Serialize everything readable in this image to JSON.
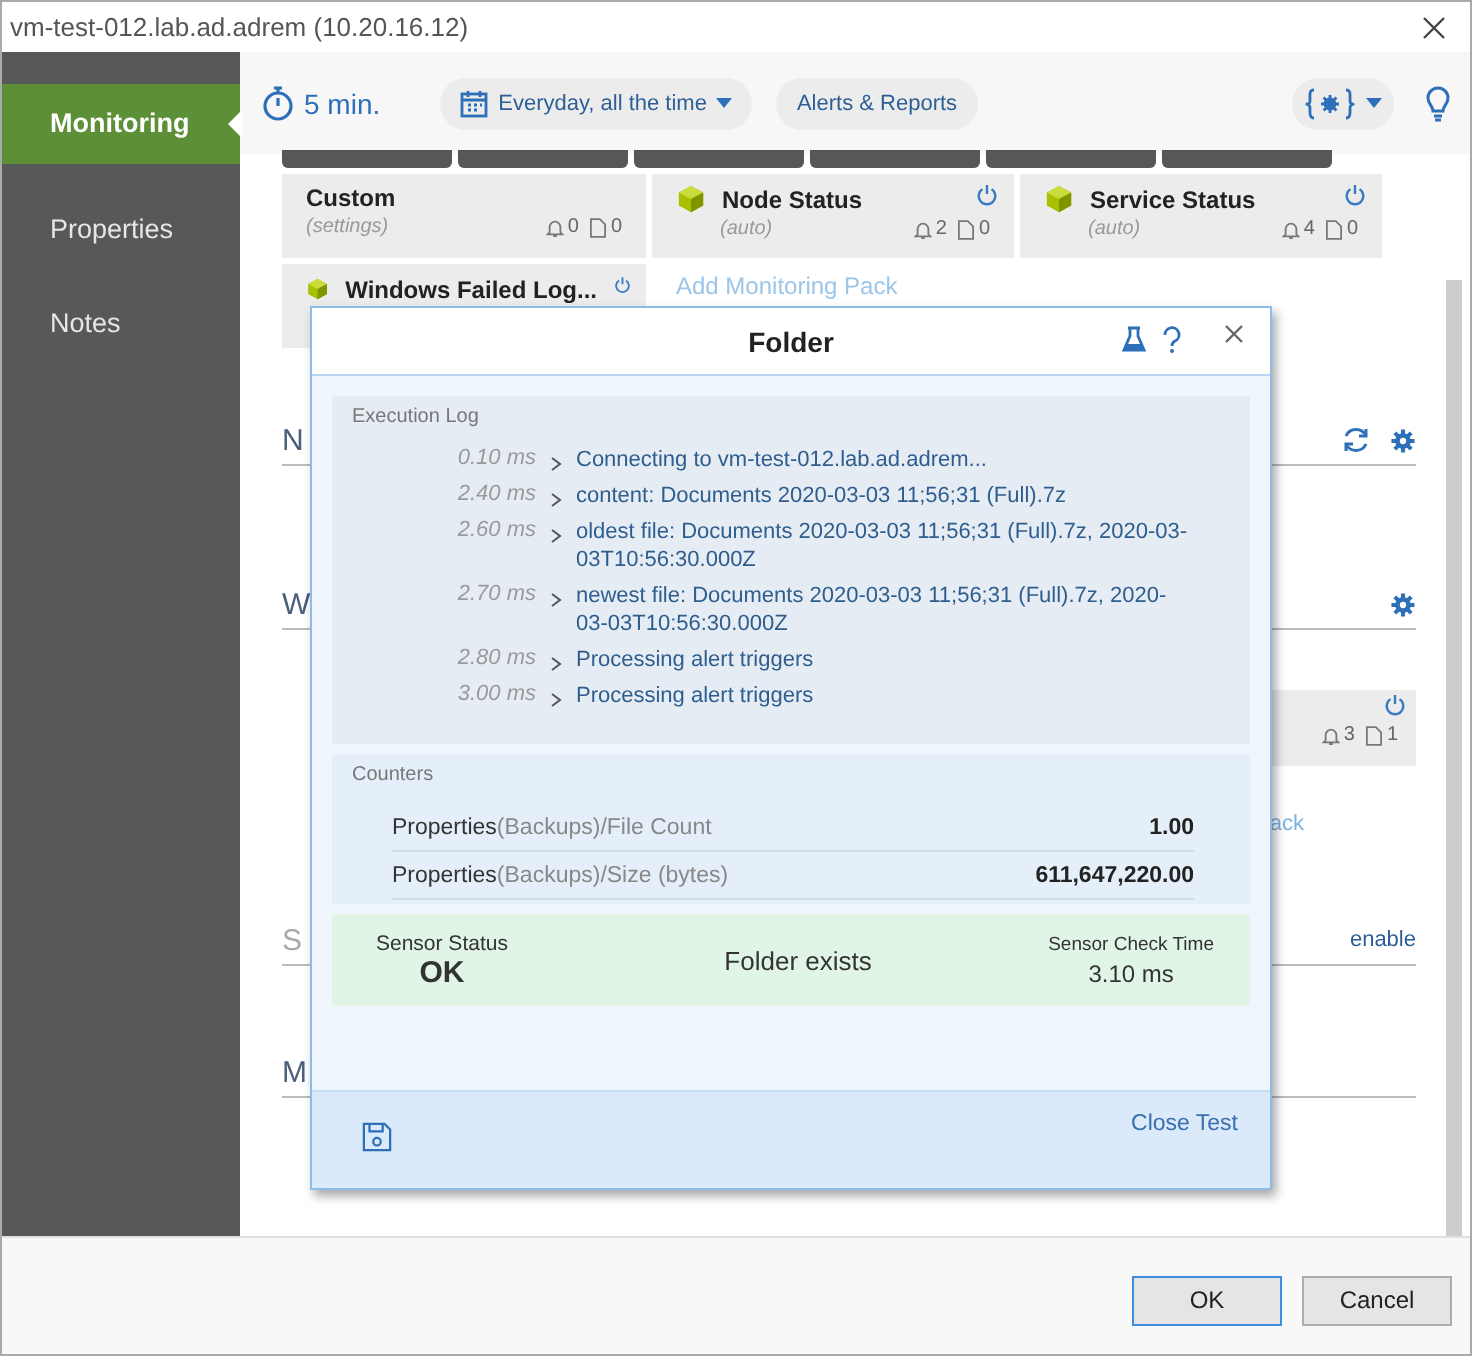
{
  "window": {
    "title": "vm-test-012.lab.ad.adrem (10.20.16.12)"
  },
  "sidebar": {
    "items": [
      {
        "label": "Monitoring",
        "selected": true
      },
      {
        "label": "Properties",
        "selected": false
      },
      {
        "label": "Notes",
        "selected": false
      }
    ]
  },
  "toolbar": {
    "interval": "5 min.",
    "schedule": "Everyday, all the time",
    "alerts_button": "Alerts & Reports"
  },
  "monitoring_packs": [
    {
      "kind": "custom",
      "name": "Custom",
      "subtitle": "(settings)",
      "alerts": "0",
      "files": "0"
    },
    {
      "kind": "pack",
      "name": "Node Status",
      "subtitle": "(auto)",
      "alerts": "2",
      "files": "0"
    },
    {
      "kind": "pack",
      "name": "Service Status",
      "subtitle": "(auto)",
      "alerts": "4",
      "files": "0"
    },
    {
      "kind": "pack",
      "name": "Windows Failed Log..."
    }
  ],
  "add_pack": "Add Monitoring Pack",
  "sections": [
    {
      "heading": "N",
      "kind": "refresh"
    },
    {
      "heading": "W",
      "kind": "pack"
    },
    {
      "heading": "S",
      "kind": "enable"
    },
    {
      "heading": "M",
      "kind": "plain"
    }
  ],
  "hidden_pack": {
    "alerts": "3",
    "files": "1",
    "link": "ack"
  },
  "enable_link": "enable",
  "dialog": {
    "title": "Folder",
    "log_title": "Execution Log",
    "log": [
      {
        "time": "0.10 ms",
        "message": "Connecting to vm-test-012.lab.ad.adrem..."
      },
      {
        "time": "2.40 ms",
        "message": "content: Documents 2020-03-03 11;56;31 (Full).7z"
      },
      {
        "time": "2.60 ms",
        "message": "oldest file: Documents 2020-03-03 11;56;31 (Full).7z, 2020-03-03T10:56:30.000Z"
      },
      {
        "time": "2.70 ms",
        "message": "newest file: Documents 2020-03-03 11;56;31 (Full).7z, 2020-03-03T10:56:30.000Z"
      },
      {
        "time": "2.80 ms",
        "message": "Processing alert triggers"
      },
      {
        "time": "3.00 ms",
        "message": "Processing alert triggers"
      }
    ],
    "counters_title": "Counters",
    "counters": [
      {
        "group": "Properties",
        "detail": "(Backups)/File Count",
        "value": "1.00"
      },
      {
        "group": "Properties",
        "detail": "(Backups)/Size (bytes)",
        "value": "611,647,220.00"
      }
    ],
    "status": {
      "label": "Sensor Status",
      "value": "OK",
      "message": "Folder exists",
      "time_label": "Sensor Check Time",
      "time": "3.10 ms"
    },
    "close_link": "Close Test"
  },
  "buttons": [
    {
      "label": "OK",
      "kind": "primary"
    },
    {
      "label": "Cancel",
      "kind": "normal"
    }
  ]
}
